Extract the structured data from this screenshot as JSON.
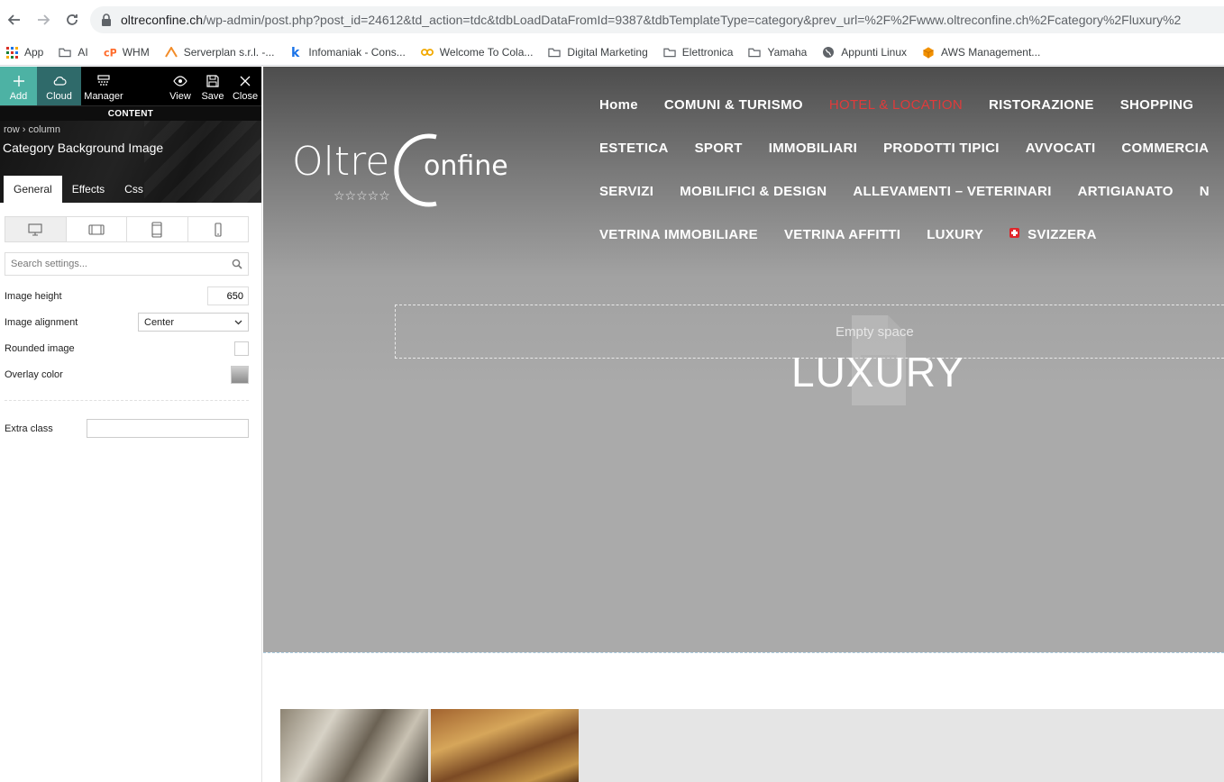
{
  "browser": {
    "url_domain": "oltreconfine.ch",
    "url_path": "/wp-admin/post.php?post_id=24612&td_action=tdc&tdbLoadDataFromId=9387&tdbTemplateType=category&prev_url=%2F%2Fwww.oltreconfine.ch%2Fcategory%2Fluxury%2"
  },
  "bookmarks": [
    {
      "label": "App",
      "icon": "apps-grid-icon"
    },
    {
      "label": "AI",
      "icon": "folder-icon"
    },
    {
      "label": "WHM",
      "icon": "cpanel-icon"
    },
    {
      "label": "Serverplan s.r.l. -...",
      "icon": "serverplan-icon"
    },
    {
      "label": "Infomaniak - Cons...",
      "icon": "infomaniak-icon"
    },
    {
      "label": "Welcome To Cola...",
      "icon": "cola-icon"
    },
    {
      "label": "Digital Marketing",
      "icon": "folder-icon"
    },
    {
      "label": "Elettronica",
      "icon": "folder-icon"
    },
    {
      "label": "Yamaha",
      "icon": "folder-icon"
    },
    {
      "label": "Appunti Linux",
      "icon": "globe-icon"
    },
    {
      "label": "AWS Management...",
      "icon": "aws-icon"
    }
  ],
  "toolbar": {
    "add": "Add",
    "cloud": "Cloud",
    "manager": "Manager",
    "view": "View",
    "save": "Save",
    "close": "Close",
    "section": "CONTENT"
  },
  "panel": {
    "breadcrumb": "row › column",
    "title": "Category Background Image",
    "tabs": [
      "General",
      "Effects",
      "Css"
    ],
    "search_placeholder": "Search settings...",
    "image_height_label": "Image height",
    "image_height_value": "650",
    "image_alignment_label": "Image alignment",
    "image_alignment_value": "Center",
    "rounded_image_label": "Rounded image",
    "overlay_color_label": "Overlay color",
    "extra_class_label": "Extra class"
  },
  "site": {
    "logo_text_1": "Oltre",
    "logo_text_2": "onfine",
    "logo_stars": "☆☆☆☆☆",
    "menu_rows": [
      [
        "Home",
        "COMUNI & TURISMO",
        "HOTEL & LOCATION",
        "RISTORAZIONE",
        "SHOPPING"
      ],
      [
        "ESTETICA",
        "SPORT",
        "IMMOBILIARI",
        "PRODOTTI TIPICI",
        "AVVOCATI",
        "COMMERCIA"
      ],
      [
        "SERVIZI",
        "MOBILIFICI & DESIGN",
        "ALLEVAMENTI – VETERINARI",
        "ARTIGIANATO",
        "N"
      ],
      [
        "VETRINA IMMOBILIARE",
        "VETRINA AFFITTI",
        "LUXURY",
        "SVIZZERA"
      ]
    ],
    "active_menu": "HOTEL & LOCATION",
    "empty_space_label": "Empty space",
    "category_title": "LUXURY"
  },
  "colors": {
    "accent_teal": "#4db2a4",
    "menu_active": "#e03b3b"
  }
}
